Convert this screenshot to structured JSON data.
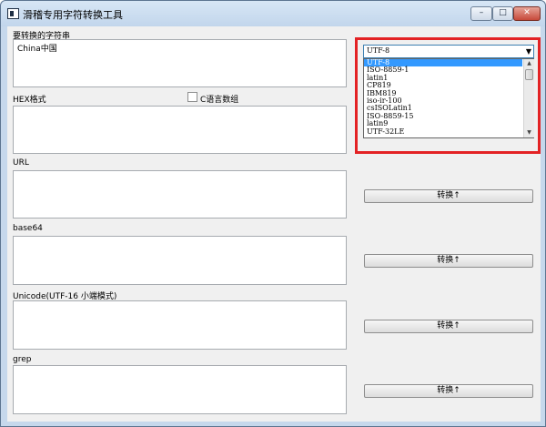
{
  "window": {
    "title": "滑稽专用字符转换工具",
    "min_glyph": "–",
    "max_glyph": "□",
    "close_glyph": "✕"
  },
  "source": {
    "label": "要转换的字符串",
    "value": "China中国"
  },
  "hex": {
    "label": "HEX格式",
    "c_array_label": "C语言数组",
    "c_array_checked": false
  },
  "url": {
    "label": "URL",
    "button": "转换↑"
  },
  "base64": {
    "label": "base64",
    "button": "转换↑"
  },
  "unicode": {
    "label": "Unicode(UTF-16 小端模式)",
    "button": "转换↑"
  },
  "grep": {
    "label": "grep",
    "button": "转换↑"
  },
  "encoding": {
    "selected": "UTF-8",
    "options": [
      "UTF-8",
      "ISO-8859-1",
      "latin1",
      "CP819",
      "IBM819",
      "iso-ir-100",
      "csISOLatin1",
      "ISO-8859-15",
      "latin9",
      "UTF-32LE"
    ]
  },
  "colors": {
    "highlight": "#e32224",
    "selection": "#3399ff"
  }
}
